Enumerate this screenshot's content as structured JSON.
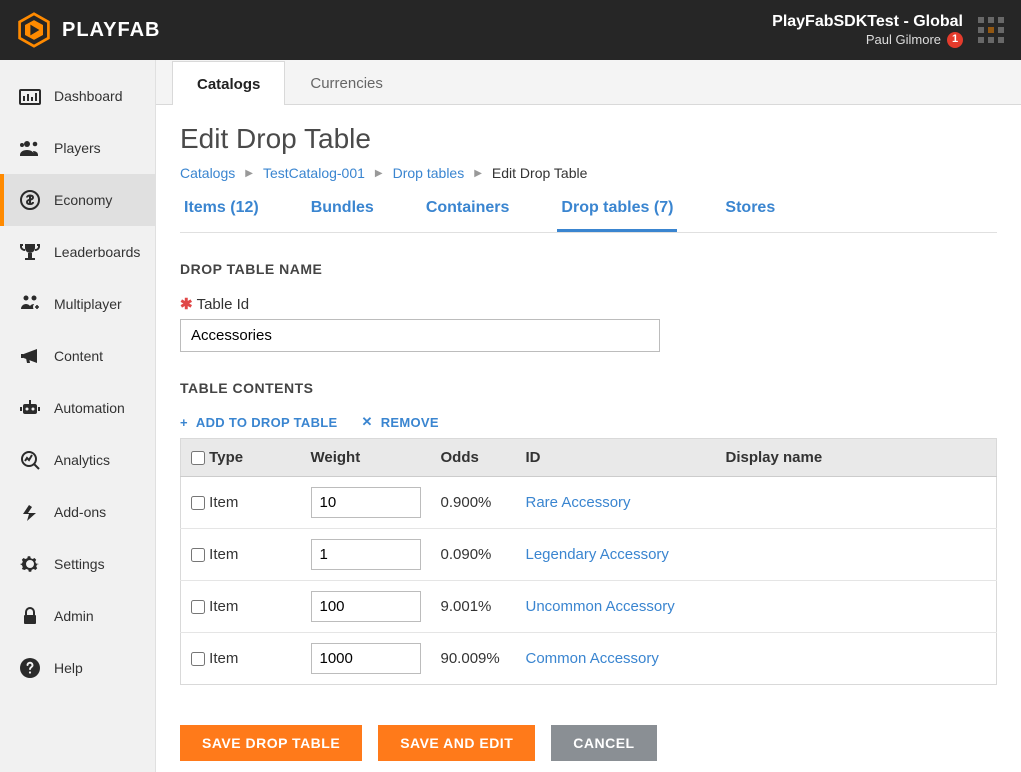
{
  "brand": "PLAYFAB",
  "header": {
    "title": "PlayFabSDKTest - Global",
    "user": "Paul Gilmore",
    "notifications": "1"
  },
  "sidebar": {
    "items": [
      {
        "key": "dashboard",
        "label": "Dashboard"
      },
      {
        "key": "players",
        "label": "Players"
      },
      {
        "key": "economy",
        "label": "Economy"
      },
      {
        "key": "leaderboards",
        "label": "Leaderboards"
      },
      {
        "key": "multiplayer",
        "label": "Multiplayer"
      },
      {
        "key": "content",
        "label": "Content"
      },
      {
        "key": "automation",
        "label": "Automation"
      },
      {
        "key": "analytics",
        "label": "Analytics"
      },
      {
        "key": "addons",
        "label": "Add-ons"
      },
      {
        "key": "settings",
        "label": "Settings"
      },
      {
        "key": "admin",
        "label": "Admin"
      },
      {
        "key": "help",
        "label": "Help"
      }
    ],
    "active": "economy"
  },
  "topTabs": {
    "items": [
      "Catalogs",
      "Currencies"
    ],
    "active": "Catalogs"
  },
  "page": {
    "heading": "Edit Drop Table",
    "breadcrumb": [
      {
        "label": "Catalogs",
        "link": true
      },
      {
        "label": "TestCatalog-001",
        "link": true
      },
      {
        "label": "Drop tables",
        "link": true
      },
      {
        "label": "Edit Drop Table",
        "link": false
      }
    ],
    "subtabs": [
      {
        "label": "Items (12)"
      },
      {
        "label": "Bundles"
      },
      {
        "label": "Containers"
      },
      {
        "label": "Drop tables (7)",
        "active": true
      },
      {
        "label": "Stores"
      }
    ],
    "section1": "DROP TABLE NAME",
    "tableIdLabel": "Table Id",
    "tableIdValue": "Accessories",
    "section2": "TABLE CONTENTS",
    "addLabel": "ADD TO DROP TABLE",
    "removeLabel": "REMOVE",
    "columns": {
      "type": "Type",
      "weight": "Weight",
      "odds": "Odds",
      "id": "ID",
      "display": "Display name"
    },
    "rows": [
      {
        "type": "Item",
        "weight": "10",
        "odds": "0.900%",
        "id": "Rare Accessory",
        "display": ""
      },
      {
        "type": "Item",
        "weight": "1",
        "odds": "0.090%",
        "id": "Legendary Accessory",
        "display": ""
      },
      {
        "type": "Item",
        "weight": "100",
        "odds": "9.001%",
        "id": "Uncommon Accessory",
        "display": ""
      },
      {
        "type": "Item",
        "weight": "1000",
        "odds": "90.009%",
        "id": "Common Accessory",
        "display": ""
      }
    ],
    "buttons": {
      "save": "SAVE DROP TABLE",
      "saveEdit": "SAVE AND EDIT",
      "cancel": "CANCEL"
    }
  }
}
